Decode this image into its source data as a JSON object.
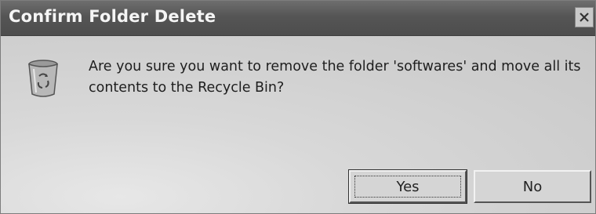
{
  "window": {
    "title": "Confirm Folder Delete",
    "close_glyph": "×"
  },
  "dialog": {
    "icon": "recycle-bin-icon",
    "message": "Are you sure you want to remove the folder 'softwares' and move all its contents to the Recycle Bin?"
  },
  "buttons": {
    "yes_label": "Yes",
    "no_label": "No"
  },
  "colors": {
    "titlebar": "#555555",
    "dialog_bg": "#d7d7d7"
  }
}
